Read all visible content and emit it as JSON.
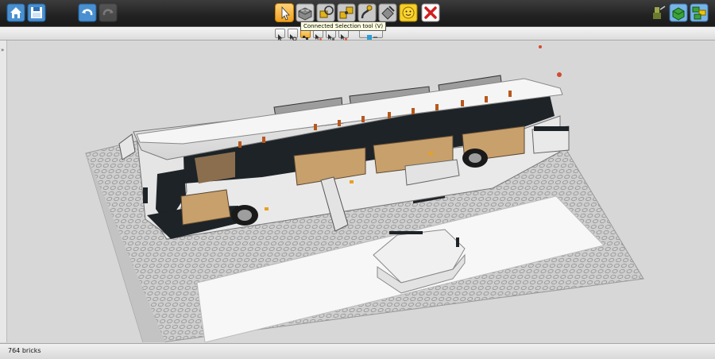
{
  "toolbar": {
    "left": [
      {
        "name": "home-button",
        "icon": "home-icon"
      },
      {
        "name": "save-button",
        "icon": "save-icon"
      },
      {
        "name": "undo-button",
        "icon": "undo-icon"
      },
      {
        "name": "redo-button",
        "icon": "redo-icon",
        "disabled": true
      }
    ],
    "tools": [
      {
        "name": "select-tool-button",
        "icon": "cursor-icon",
        "active": true
      },
      {
        "name": "clone-tool-button",
        "icon": "clone-brick-icon"
      },
      {
        "name": "hinge-tool-button",
        "icon": "hinge-icon"
      },
      {
        "name": "hinge-align-tool-button",
        "icon": "hinge-align-icon"
      },
      {
        "name": "flex-tool-button",
        "icon": "flex-icon"
      },
      {
        "name": "paint-tool-button",
        "icon": "paint-bucket-icon"
      },
      {
        "name": "hide-tool-button",
        "icon": "minifig-head-icon"
      },
      {
        "name": "delete-tool-button",
        "icon": "delete-x-icon"
      }
    ],
    "right": [
      {
        "name": "view-mode-button",
        "icon": "minifig-tools-icon"
      },
      {
        "name": "build-mode-button",
        "icon": "green-brick-icon"
      },
      {
        "name": "brick-palette-button",
        "icon": "multi-brick-icon"
      }
    ]
  },
  "subtoolbar": {
    "tooltip": "Connected Selection tool (V)",
    "tools": [
      {
        "name": "single-select-button",
        "icon": "cursor-small-icon"
      },
      {
        "name": "multi-select-button",
        "icon": "multi-select-icon"
      },
      {
        "name": "connected-select-button",
        "icon": "connected-select-icon",
        "active": true
      },
      {
        "name": "color-select-button",
        "icon": "color-select-icon"
      },
      {
        "name": "shape-select-button",
        "icon": "shape-select-icon"
      },
      {
        "name": "color-shape-select-button",
        "icon": "color-shape-select-icon"
      },
      {
        "name": "invert-select-button",
        "icon": "invert-select-icon"
      }
    ]
  },
  "status": {
    "brick_count": "764 bricks"
  },
  "colors": {
    "toolbar_bg": "#222222",
    "active_tool": "#f0a020",
    "canvas_bg": "#d7d7d7",
    "baseplate": "#d0d0d0",
    "bus_white": "#e9e9e9",
    "window_black": "#1d2327",
    "seat_tan": "#c8a06c"
  }
}
